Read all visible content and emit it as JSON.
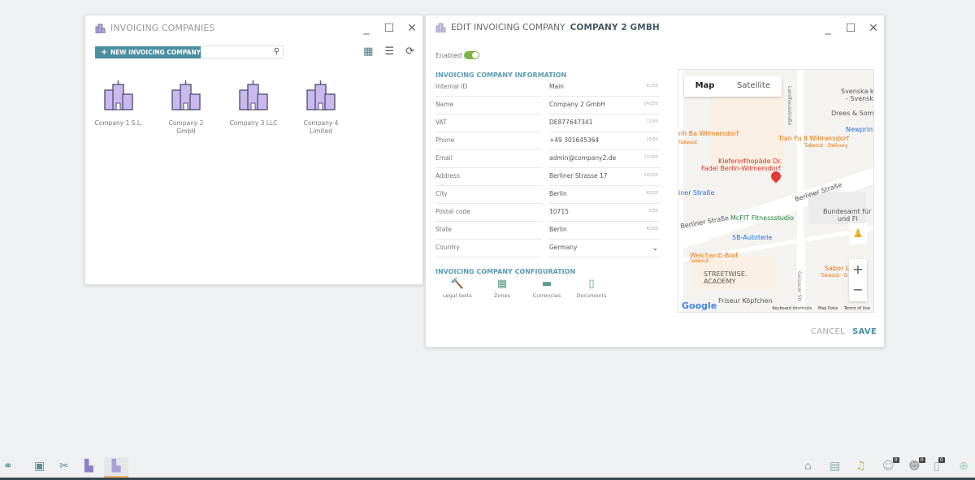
{
  "list_window": {
    "title": "INVOICING COMPANIES",
    "new_button": "NEW INVOICING COMPANY",
    "search_placeholder": "",
    "companies": [
      {
        "l1": "Company 1 S.L.",
        "l2": ""
      },
      {
        "l1": "Company 2",
        "l2": "GmbH"
      },
      {
        "l1": "Company 3 LLC",
        "l2": ""
      },
      {
        "l1": "Company 4",
        "l2": "Limited"
      }
    ]
  },
  "edit_window": {
    "title_prefix": "EDIT INVOICING COMPANY",
    "title_name": "COMPANY 2 GMBH",
    "enabled_label": "Enabled",
    "enabled": true,
    "info_section": "INVOICING COMPANY INFORMATION",
    "fields": [
      {
        "label": "Internal ID",
        "value": "Main",
        "count": "4/255"
      },
      {
        "label": "Name",
        "value": "Company 2 GmbH",
        "count": "14/255"
      },
      {
        "label": "VAT",
        "value": "DE877647341",
        "count": "11/50"
      },
      {
        "label": "Phone",
        "value": "+49 301645364",
        "count": "13/50"
      },
      {
        "label": "Email",
        "value": "admin@company2.de",
        "count": "17/255"
      },
      {
        "label": "Address",
        "value": "Berliner Strasse 17",
        "count": "19/255"
      },
      {
        "label": "City",
        "value": "Berlin",
        "count": "6/255"
      },
      {
        "label": "Postal code",
        "value": "10715",
        "count": "5/50"
      },
      {
        "label": "State",
        "value": "Berlin",
        "count": "6/255"
      },
      {
        "label": "Country",
        "value": "Germany",
        "count": ""
      }
    ],
    "config_section": "INVOICING COMPANY CONFIGURATION",
    "config_items": [
      {
        "label": "Legal texts",
        "icon": "gavel-icon"
      },
      {
        "label": "Zones",
        "icon": "map-icon"
      },
      {
        "label": "Currencies",
        "icon": "money-icon"
      },
      {
        "label": "Documents",
        "icon": "document-icon"
      }
    ],
    "cancel": "CANCEL",
    "save": "SAVE",
    "map": {
      "tab_map": "Map",
      "tab_satellite": "Satellite",
      "zoom_in": "+",
      "zoom_out": "−",
      "google": "Google",
      "keyboard": "Keyboard shortcuts",
      "map_data": "Map Data",
      "terms": "Terms of Use",
      "labels": [
        "Svenska kyrkan",
        "- Svenska...",
        "Drees & Sommer",
        "Newprint",
        "nh Ba Wilmersdorf",
        "Takeout",
        "Tian Fu II Wilmersdorf",
        "Takeout · Delivery",
        "Kieferorthopäde Dr.",
        "Fadel Berlin-Wilmersdorf",
        "iner Straße",
        "Berliner Straße",
        "Berliner Straße",
        "McFIT Fitnessstudio",
        "Bundesamt für M",
        "und Fl",
        "SB-Autoteile",
        "Weichardt-Brot",
        "Takeout",
        "STREETWISE.",
        "ACADEMY",
        "Sabor L",
        "Takeout · D",
        "Friseur Köpfchen",
        "Landhausstraße",
        "Geisauer Str."
      ]
    }
  },
  "taskbar": {
    "badges": [
      "0",
      "0",
      "0"
    ]
  },
  "colors": {
    "accent": "#4a8fa0",
    "toggle": "#7cb342",
    "save": "#4a8fa0"
  }
}
